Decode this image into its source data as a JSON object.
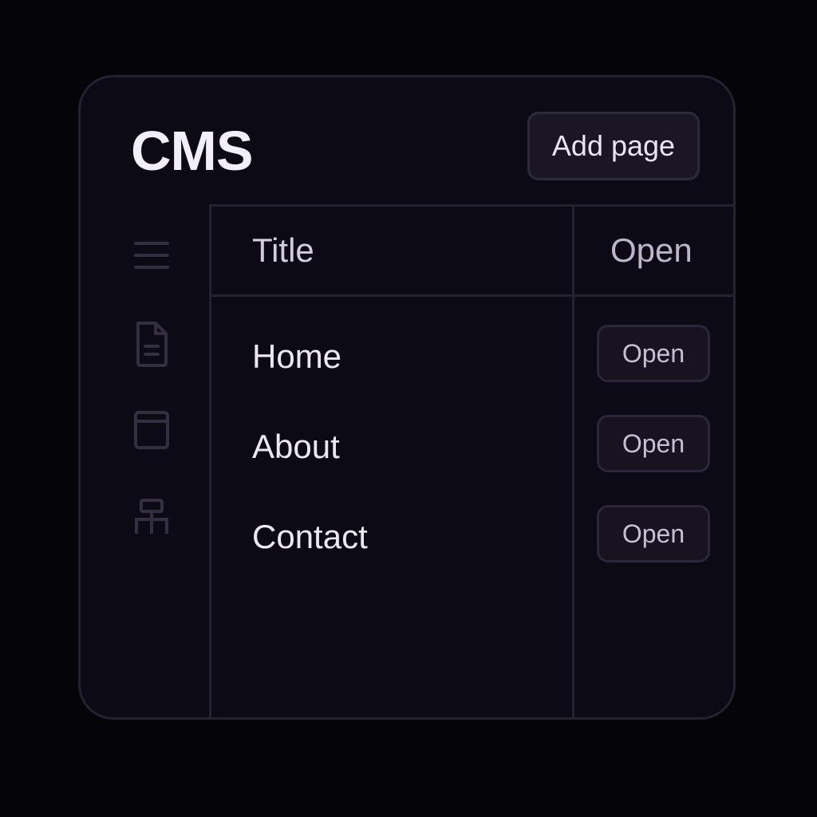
{
  "app": {
    "title": "CMS",
    "add_button_label": "Add page"
  },
  "sidebar": {
    "icons": [
      "menu-icon",
      "document-icon",
      "layout-icon",
      "sitemap-icon"
    ]
  },
  "table": {
    "columns": [
      "Title",
      "Open"
    ],
    "rows": [
      {
        "title": "Home",
        "action": "Open"
      },
      {
        "title": "About",
        "action": "Open"
      },
      {
        "title": "Contact",
        "action": "Open"
      }
    ]
  },
  "colors": {
    "background": "#050408",
    "panel": "#0c0a14",
    "border": "#25212f",
    "text": "#ece8f3"
  }
}
